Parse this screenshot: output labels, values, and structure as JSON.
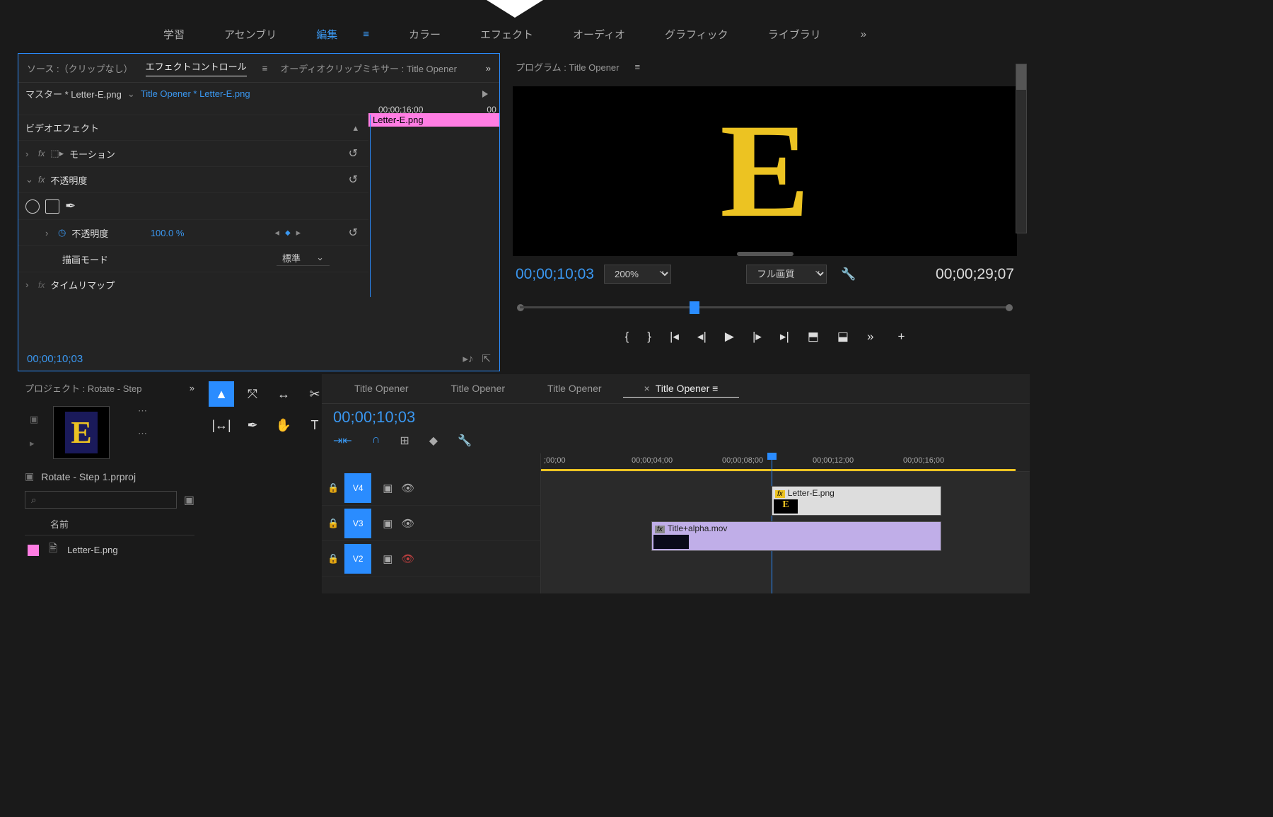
{
  "workspaces": {
    "learn": "学習",
    "assembly": "アセンブリ",
    "edit": "編集",
    "color": "カラー",
    "effects": "エフェクト",
    "audio": "オーディオ",
    "graphics": "グラフィック",
    "library": "ライブラリ"
  },
  "source_panel": {
    "source_tab": "ソース :（クリップなし）",
    "effect_controls_tab": "エフェクトコントロール",
    "audio_mixer_tab": "オーディオクリップミキサー : Title Opener",
    "master": "マスター * Letter-E.png",
    "sequence": "Title Opener * Letter-E.png",
    "time_head_1": "00;00;16;00",
    "time_head_2": "00",
    "clip_label": "Letter-E.png",
    "video_effects": "ビデオエフェクト",
    "motion": "モーション",
    "opacity": "不透明度",
    "opacity_val": "100.0 %",
    "blend_mode_label": "描画モード",
    "blend_mode_val": "標準",
    "time_remap": "タイムリマップ",
    "timecode": "00;00;10;03"
  },
  "program": {
    "title": "プログラム : Title Opener",
    "tc_in": "00;00;10;03",
    "tc_out": "00;00;29;07",
    "zoom": "200%",
    "quality": "フル画質"
  },
  "project": {
    "title": "プロジェクト : Rotate - Step",
    "project_file": "Rotate - Step 1.prproj",
    "name_col": "名前",
    "bin_item": "Letter-E.png"
  },
  "timeline": {
    "tabs": [
      "Title Opener",
      "Title Opener",
      "Title Opener",
      "Title Opener"
    ],
    "tc": "00;00;10;03",
    "ruler": [
      ";00;00",
      "00;00;04;00",
      "00;00;08;00",
      "00;00;12;00",
      "00;00;16;00"
    ],
    "tracks": {
      "v4": "V4",
      "v3": "V3",
      "v2": "V2"
    },
    "clip_letter": "Letter-E.png",
    "clip_alpha": "Title+alpha.mov",
    "fx": "fx"
  }
}
